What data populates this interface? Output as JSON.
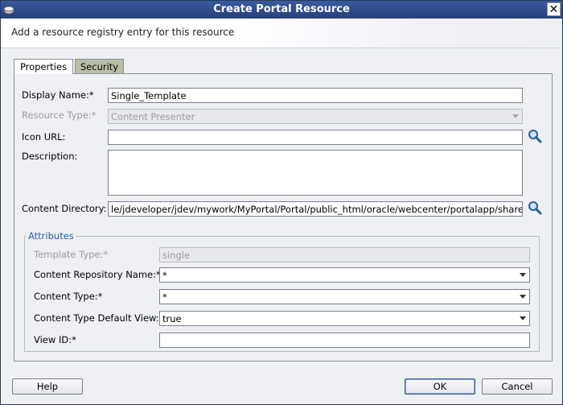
{
  "window": {
    "title": "Create Portal Resource",
    "close_label": "✕"
  },
  "header": {
    "description": "Add a resource registry entry for this resource"
  },
  "tabs": [
    {
      "label": "Properties",
      "active": true
    },
    {
      "label": "Security",
      "active": false
    }
  ],
  "form": {
    "display_name": {
      "label": "Display Name:*",
      "value": "Single_Template"
    },
    "resource_type": {
      "label": "Resource Type:*",
      "value": "Content Presenter"
    },
    "icon_url": {
      "label": "Icon URL:",
      "value": ""
    },
    "description": {
      "label": "Description:",
      "value": ""
    },
    "content_directory": {
      "label": "Content Directory:",
      "value": "le/jdeveloper/jdev/mywork/MyPortal/Portal/public_html/oracle/webcenter/portalapp/shared/"
    }
  },
  "attributes": {
    "title": "Attributes",
    "template_type": {
      "label": "Template Type:*",
      "value": "single"
    },
    "content_repository_name": {
      "label": "Content Repository Name:*",
      "value": "*"
    },
    "content_type": {
      "label": "Content Type:*",
      "value": "*"
    },
    "content_type_default_view": {
      "label": "Content Type Default View:*",
      "value": "true"
    },
    "view_id": {
      "label": "View ID:*",
      "value": ""
    }
  },
  "buttons": {
    "help": "Help",
    "ok": "OK",
    "cancel": "Cancel"
  },
  "colors": {
    "titlebar": "#26407a",
    "inactive_tab": "#b9bfa5",
    "group_title": "#2a5ea8"
  },
  "icons": {
    "search": "magnifier-icon",
    "close": "close-icon"
  }
}
